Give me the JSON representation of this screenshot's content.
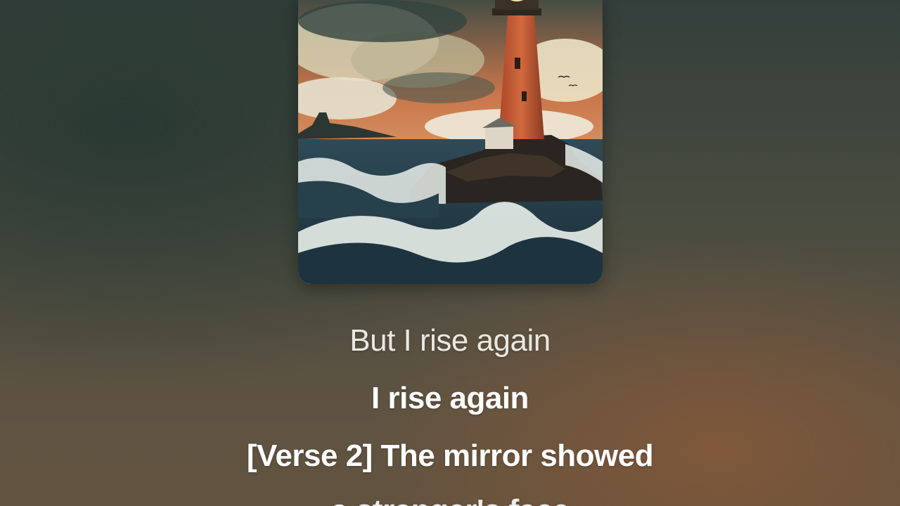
{
  "artwork": {
    "icon": "lighthouse-cover-art"
  },
  "lyrics": {
    "lines": [
      "But I rise again",
      "I rise again",
      "[Verse 2] The mirror showed",
      "a stranger's face"
    ]
  },
  "colors": {
    "text": "#ffffff",
    "background_top": "#343f3b",
    "background_bottom": "#62533f",
    "accent_warm": "#845838"
  }
}
